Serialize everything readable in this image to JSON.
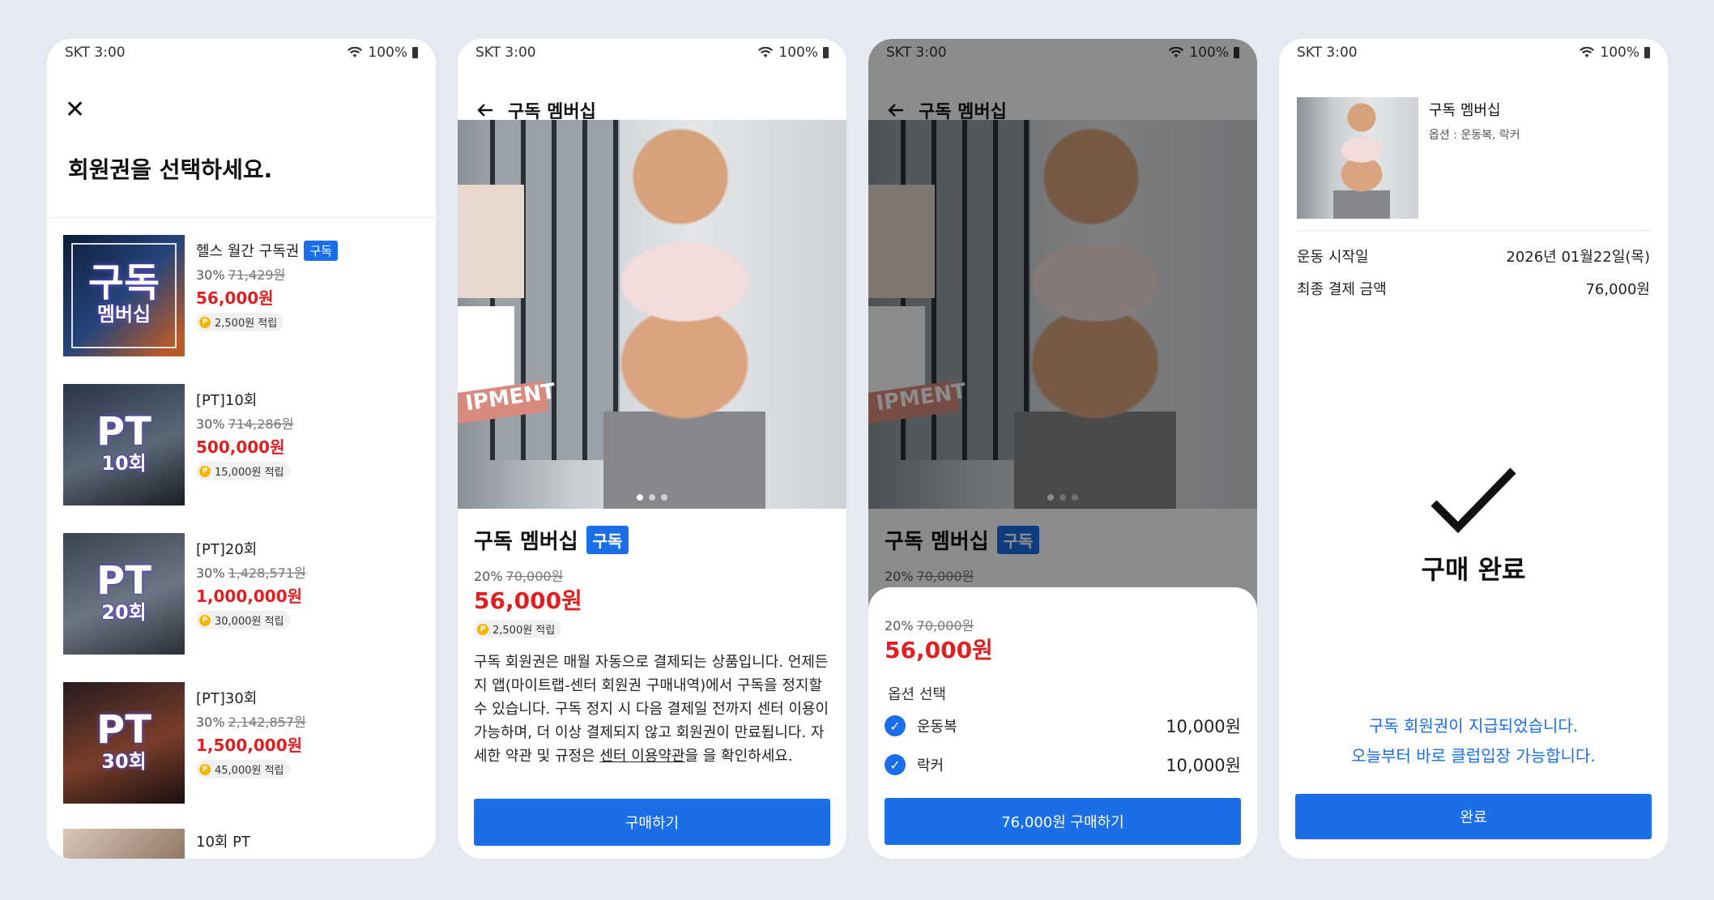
{
  "status": {
    "carrier_time": "SKT 3:00",
    "battery": "100%"
  },
  "screen1": {
    "heading": "회원권을 선택하세요.",
    "items": [
      {
        "thumb_big": "구독",
        "thumb_small": "멤버십",
        "name": "헬스 월간 구독권",
        "badge": "구독",
        "discount": "30%",
        "original": "71,429원",
        "price": "56,000원",
        "point": "2,500원 적립"
      },
      {
        "thumb_big": "PT",
        "thumb_small": "10회",
        "name": "[PT]10회",
        "badge": "",
        "discount": "30%",
        "original": "714,286원",
        "price": "500,000원",
        "point": "15,000원 적립"
      },
      {
        "thumb_big": "PT",
        "thumb_small": "20회",
        "name": "[PT]20회",
        "badge": "",
        "discount": "30%",
        "original": "1,428,571원",
        "price": "1,000,000원",
        "point": "30,000원 적립"
      },
      {
        "thumb_big": "PT",
        "thumb_small": "30회",
        "name": "[PT]30회",
        "badge": "",
        "discount": "30%",
        "original": "2,142,857원",
        "price": "1,500,000원",
        "point": "45,000원 적립"
      }
    ],
    "partial_item_name": "10회 PT"
  },
  "screen2": {
    "nav_title": "구독 멤버십",
    "banner_text": "IPMENT",
    "product_name": "구독 멤버십",
    "badge": "구독",
    "discount": "20%",
    "original": "70,000원",
    "price": "56,000원",
    "point": "2,500원 적립",
    "desc_pre": "구독 회원권은 매월 자동으로 결제되는 상품입니다. 언제든지 앱(마이트랩-센터 회원권 구매내역)에서 구독을 정지할 수 있습니다. 구독 정지 시 다음 결제일 전까지 센터 이용이 가능하며, 더 이상 결제되지 않고 회원권이 만료됩니다. 자세한 약관 및 규정은 ",
    "desc_link": "센터 이용약관",
    "desc_post": "을 을 확인하세요.",
    "buy_button": "구매하기"
  },
  "screen3": {
    "nav_title": "구독 멤버십",
    "product_name": "구독 멤버십",
    "badge": "구독",
    "discount": "20%",
    "original": "70,000원",
    "price": "56,000원",
    "option_label": "옵션 선택",
    "options": [
      {
        "name": "운동복",
        "price": "10,000원",
        "checked": true
      },
      {
        "name": "락커",
        "price": "10,000원",
        "checked": true
      }
    ],
    "buy_button": "76,000원 구매하기"
  },
  "screen4": {
    "product_name": "구독 멤버십",
    "option_summary": "옵션 : 운동복, 락커",
    "start_label": "운동 시작일",
    "start_value": "2026년 01월22일(목)",
    "total_label": "최종 결제 금액",
    "total_value": "76,000원",
    "done_title": "구매 완료",
    "message_line1": "구독 회원권이 지급되었습니다.",
    "message_line2": "오늘부터 바로 클럽입장 가능합니다.",
    "confirm_button": "완료"
  },
  "colors": {
    "accent": "#1a6ee8",
    "price": "#e02020",
    "background": "#e6e9f2"
  }
}
